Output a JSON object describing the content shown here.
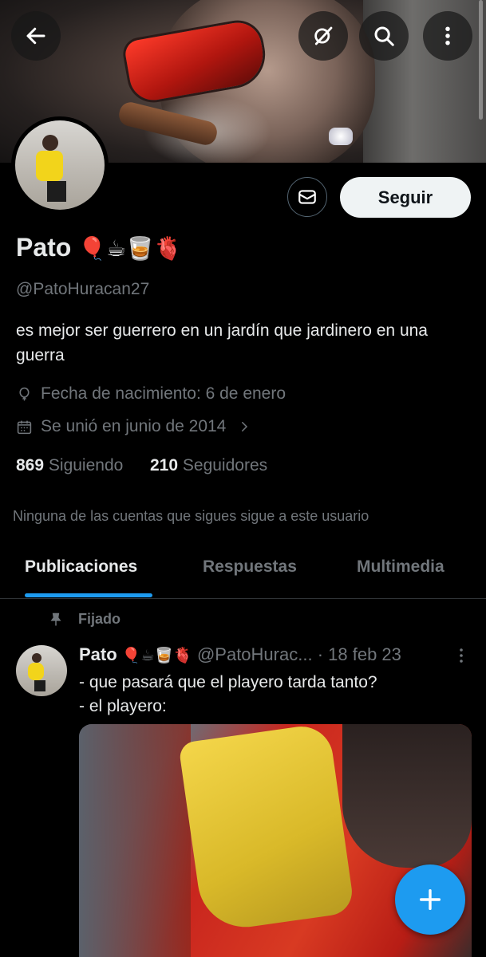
{
  "header": {
    "back_icon": "arrow-left-icon",
    "actions": [
      "grok-icon",
      "search-icon",
      "more-vertical-icon"
    ]
  },
  "profile": {
    "name": "Pato",
    "name_emojis": "🎈☕🥃🫀",
    "handle": "@PatoHuracan27",
    "bio": "es mejor ser guerrero en un jardín que jardinero en una guerra",
    "birthday": "Fecha de nacimiento: 6 de enero",
    "joined": "Se unió en junio de 2014",
    "following_count": "869",
    "following_label": "Siguiendo",
    "followers_count": "210",
    "followers_label": "Seguidores",
    "mutuals_text": "Ninguna de las cuentas que sigues sigue a este usuario",
    "follow_label": "Seguir"
  },
  "tabs": [
    {
      "label": "Publicaciones",
      "active": true
    },
    {
      "label": "Respuestas",
      "active": false
    },
    {
      "label": "Multimedia",
      "active": false
    }
  ],
  "pinned_tweet": {
    "pinned_label": "Fijado",
    "author_name": "Pato",
    "author_emojis": "🎈☕🥃🫀",
    "author_handle": "@PatoHurac...",
    "date": "· 18 feb 23",
    "text": "- que pasará que el playero tarda tanto?\n- el playero:"
  },
  "colors": {
    "accent": "#1d9bf0",
    "background": "#000000",
    "secondary_text": "#71767b"
  }
}
